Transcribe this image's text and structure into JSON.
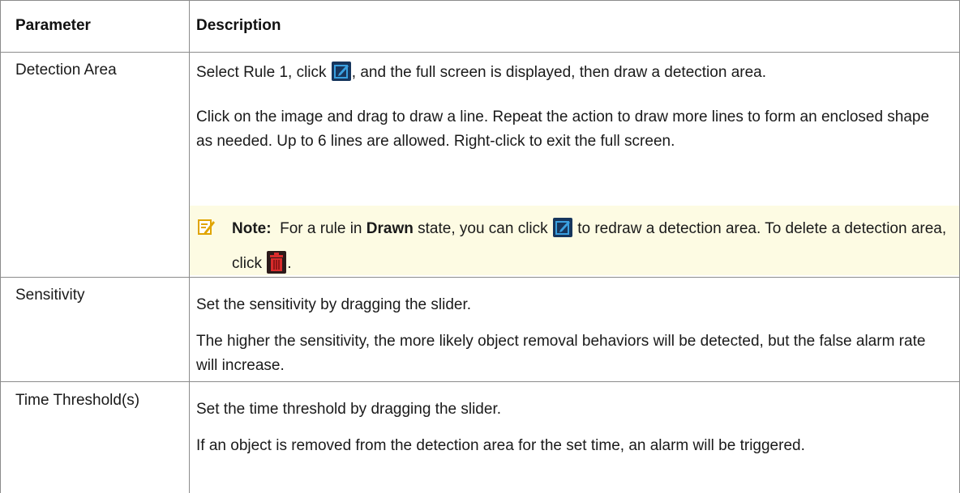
{
  "header": {
    "parameter": "Parameter",
    "description": "Description"
  },
  "rows": [
    {
      "parameter": "Detection Area",
      "para1_a": "Select Rule 1, click",
      "para1_b": ", and the full screen is displayed, then draw a detection area.",
      "para2": "Click on the image and drag to draw a line. Repeat the action to draw more lines to form an enclosed shape as needed. Up to 6 lines are allowed. Right-click to exit the full screen.",
      "note": {
        "label": "Note:",
        "text_a": "For a rule in",
        "bold": "Drawn",
        "text_b": "state, you can click",
        "text_c": "to redraw a detection area. To delete a detection area, click",
        "text_d": "."
      }
    },
    {
      "parameter": "Sensitivity",
      "para1": "Set the sensitivity by dragging the slider.",
      "para2": "The higher the sensitivity, the more likely object removal behaviors will be detected, but the false alarm rate will increase."
    },
    {
      "parameter": "Time Threshold(s)",
      "para1": "Set the time threshold by dragging the slider.",
      "para2": "If an object is removed from the detection area for the set time, an alarm will be triggered."
    }
  ],
  "colors": {
    "note_background": "#fdfbe3",
    "edit_icon": "#17365d",
    "trash_icon": "#d92b2b",
    "border": "#8c8c8c"
  },
  "icons": [
    "edit-icon",
    "trash-icon",
    "note-pencil-icon"
  ]
}
